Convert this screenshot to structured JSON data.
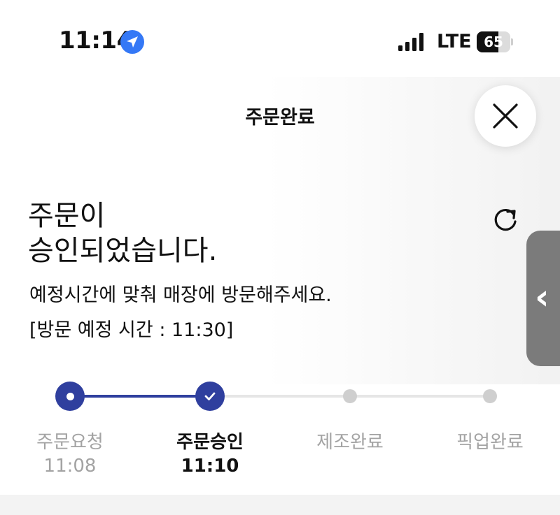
{
  "status_bar": {
    "time": "11:14",
    "network": "LTE",
    "battery_percent": "65",
    "battery_level": 0.65,
    "location_icon": "location-arrow-icon",
    "signal_icon": "cellular-signal-icon"
  },
  "header": {
    "title": "주문완료",
    "close_icon": "close-icon"
  },
  "message": {
    "headline_line1": "주문이",
    "headline_line2": "승인되었습니다.",
    "instruction": "예정시간에 맞춰 매장에 방문해주세요.",
    "visit_time": "[방문 예정 시간 : 11:30]",
    "refresh_icon": "refresh-icon"
  },
  "side_handle": {
    "glyph": "‹",
    "icon": "chevron-left-icon"
  },
  "progress": {
    "steps": [
      {
        "label": "주문요청",
        "time": "11:08",
        "state": "done"
      },
      {
        "label": "주문승인",
        "time": "11:10",
        "state": "current"
      },
      {
        "label": "제조완료",
        "time": "",
        "state": "pending"
      },
      {
        "label": "픽업완료",
        "time": "",
        "state": "pending"
      }
    ]
  },
  "colors": {
    "accent": "#2f3f9e",
    "inactive_text": "#a3a3a3",
    "inactive_dot": "#cfcfcf",
    "track_pending": "#e6e6e6",
    "side_handle": "#7b7b7b"
  }
}
